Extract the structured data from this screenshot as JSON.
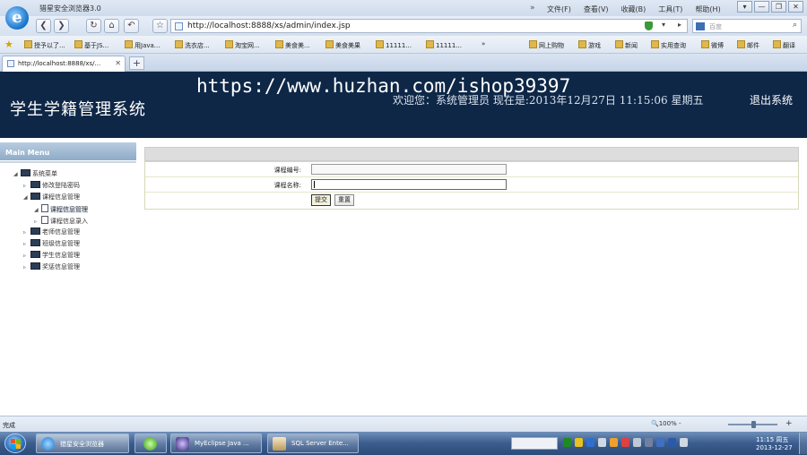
{
  "browser": {
    "app_title": "猎星安全浏览器3.0",
    "menu": [
      "文件(F)",
      "查看(V)",
      "收藏(B)",
      "工具(T)",
      "帮助(H)"
    ],
    "menu_arrow": "»",
    "window_buttons": [
      "▾",
      "—",
      "❐",
      "✕"
    ],
    "url": "http://localhost:8888/xs/admin/index.jsp",
    "search_placeholder": "百度",
    "favorites": [
      {
        "label": "授予以了..."
      },
      {
        "label": "基于JS..."
      },
      {
        "label": "用Java..."
      },
      {
        "label": "洗衣店..."
      },
      {
        "label": "淘宝网..."
      },
      {
        "label": "美食美..."
      },
      {
        "label": "美食美果"
      },
      {
        "label": "11111..."
      },
      {
        "label": "11111..."
      },
      {
        "label": "»"
      },
      {
        "label": "网上购物"
      },
      {
        "label": "游戏"
      },
      {
        "label": "新闻"
      },
      {
        "label": "实用查询"
      },
      {
        "label": "微博"
      },
      {
        "label": "邮件"
      },
      {
        "label": "翻译"
      }
    ],
    "tab_label": "http://localhost:8888/xs/...",
    "new_tab": "+"
  },
  "header": {
    "title": "学生学籍管理系统",
    "watermark": "https://www.huzhan.com/ishop39397",
    "welcome": "欢迎您：系统管理员   现在是:2013年12月27日 11:15:06 星期五",
    "logout": "退出系统"
  },
  "sidebar": {
    "heading": "Main Menu",
    "tree": [
      {
        "label": "系统菜单",
        "toggle": "◢",
        "type": "folder"
      },
      {
        "label": "修改登陆密码",
        "toggle": "▹",
        "type": "folder"
      },
      {
        "label": "课程信息管理",
        "toggle": "◢",
        "type": "folder"
      },
      {
        "label": "课程信息管理",
        "toggle": "◢",
        "type": "doc"
      },
      {
        "label": "课程信息录入",
        "toggle": "▹",
        "type": "doc"
      },
      {
        "label": "老师信息管理",
        "toggle": "▹",
        "type": "folder"
      },
      {
        "label": "班级信息管理",
        "toggle": "▹",
        "type": "folder"
      },
      {
        "label": "学生信息管理",
        "toggle": "▹",
        "type": "folder"
      },
      {
        "label": "奖惩信息管理",
        "toggle": "▹",
        "type": "folder"
      }
    ]
  },
  "form": {
    "fields": [
      {
        "label": "课程编号:",
        "value": ""
      },
      {
        "label": "课程名称:",
        "value": ""
      }
    ],
    "submit_label": "提交",
    "reset_label": "重置"
  },
  "statusbar": {
    "text": "完成",
    "zoom": "🔍100%",
    "zoom_minus": "-"
  },
  "taskbar": {
    "tasks": [
      {
        "label": "猎星安全浏览器"
      },
      {
        "label": ""
      },
      {
        "label": "MyEclipse Java ..."
      },
      {
        "label": "SQL Server Ente..."
      }
    ],
    "clock_time": "11:15 周五",
    "clock_date": "2013-12-27"
  },
  "colors": {
    "header_bg": "#0e2747",
    "chrome_bg": "#dfe8f4",
    "taskbar_bg": "#3b5d8e"
  }
}
